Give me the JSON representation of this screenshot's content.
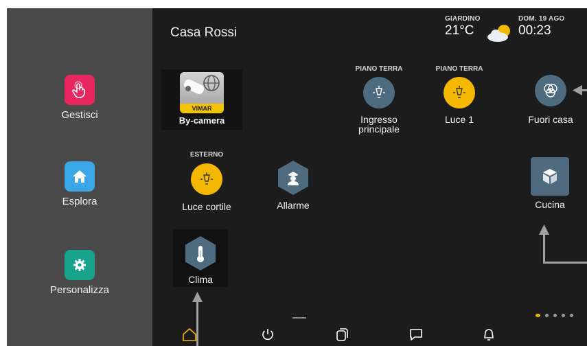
{
  "colors": {
    "background": "#1c1c1c",
    "sidebar": "#4a4a4a",
    "accent_yellow": "#f5b800",
    "tile_blue_gray": "#4e6b80",
    "gestisci_pink": "#e8275f",
    "esplora_blue": "#3aa7e6",
    "personalizza_teal": "#17a38c"
  },
  "sidebar": {
    "items": [
      {
        "label": "Gestisci",
        "icon": "hand-pointer-icon"
      },
      {
        "label": "Esplora",
        "icon": "home-icon"
      },
      {
        "label": "Personalizza",
        "icon": "gear-icon"
      }
    ]
  },
  "header": {
    "title": "Casa Rossi",
    "weather": {
      "location": "GIARDINO",
      "temperature": "21°C",
      "icon": "partly-cloudy-icon"
    },
    "datetime": {
      "date": "DOM. 19 AGO",
      "time": "00:23"
    }
  },
  "tiles": {
    "bycamera": {
      "label": "By-camera",
      "badge": "VIMAR",
      "icon": "camera-globe-icon"
    },
    "ingresso": {
      "category": "PIANO TERRA",
      "label_line1": "Ingresso",
      "label_line2": "principale",
      "icon": "lamp-icon",
      "state": "off"
    },
    "luce1": {
      "category": "PIANO TERRA",
      "label": "Luce 1",
      "icon": "lamp-icon",
      "state": "on"
    },
    "fuoricasa": {
      "label": "Fuori casa",
      "icon": "scenario-play-icon"
    },
    "lucecortile": {
      "category": "ESTERNO",
      "label": "Luce cortile",
      "icon": "lamp-icon",
      "state": "on"
    },
    "allarme": {
      "label": "Allarme",
      "icon": "guard-icon"
    },
    "cucina": {
      "label": "Cucina",
      "icon": "cube-icon"
    },
    "clima": {
      "label": "Clima",
      "icon": "thermometer-icon"
    }
  },
  "navbar": {
    "items": [
      "home-icon",
      "power-icon",
      "copy-icon",
      "chat-icon",
      "bell-icon"
    ],
    "active": "home-icon"
  },
  "pagination": {
    "pages": 5,
    "current": 1
  }
}
